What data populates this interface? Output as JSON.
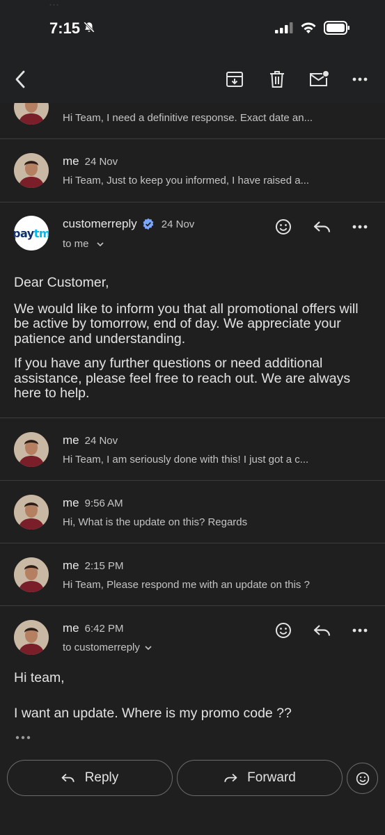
{
  "status_bar": {
    "time": "7:15"
  },
  "background_fragment": "...",
  "thread": [
    {
      "sender": "me",
      "date": "24 Nov",
      "snippet": "Hi Team, I need a definitive response. Exact date an..."
    },
    {
      "sender": "me",
      "date": "24 Nov",
      "snippet": "Hi Team, Just to keep you informed, I have raised a..."
    }
  ],
  "expanded_message": {
    "logo_text": "paytm",
    "sender": "customerreply",
    "date": "24 Nov",
    "recipient": "to me",
    "greeting": "Dear Customer,",
    "paragraph1": "We would like to inform you that all promotional offers will be active by tomorrow, end of day. We appreciate your patience and understanding.",
    "paragraph2": "If you have any further questions or need additional assistance, please feel free to reach out. We are always here to help."
  },
  "thread_after": [
    {
      "sender": "me",
      "date": "24 Nov",
      "snippet": "Hi Team, I am seriously done with this! I just got a c..."
    },
    {
      "sender": "me",
      "date": "9:56 AM",
      "snippet": "Hi, What is the update on this? Regards"
    },
    {
      "sender": "me",
      "date": "2:15 PM",
      "snippet": "Hi Team, Please respond me with an update on this ?"
    }
  ],
  "last_message": {
    "sender": "me",
    "date": "6:42 PM",
    "recipient": "to customerreply",
    "line1": "Hi team,",
    "line2": "I want an update. Where is my promo code ??"
  },
  "bottom_actions": {
    "reply": "Reply",
    "forward": "Forward"
  },
  "colors": {
    "background": "#1f1f1f",
    "verified": "#7aa7ff",
    "paytm_blue": "#00baf2",
    "paytm_navy": "#0c2f6e"
  }
}
